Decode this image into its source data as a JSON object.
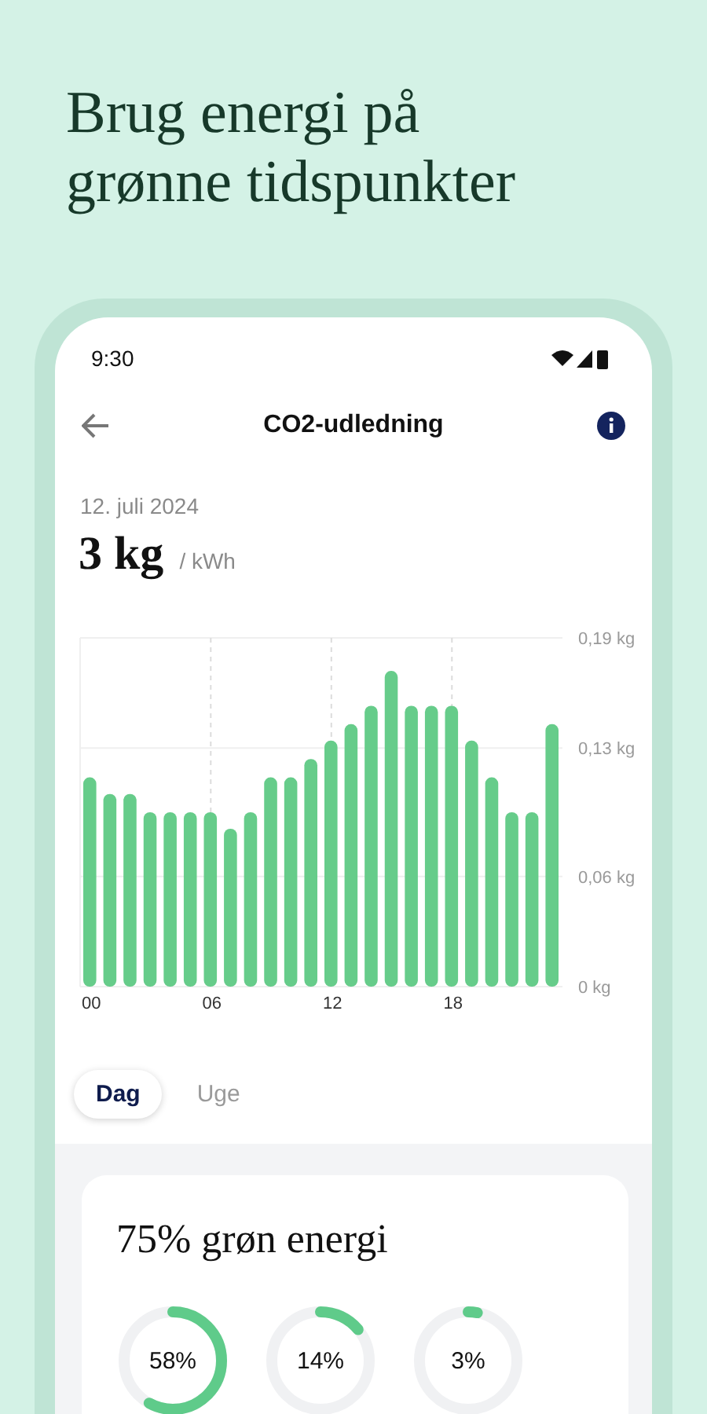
{
  "headline": "Brug energi på grønne tidspunkter",
  "status_bar": {
    "time": "9:30"
  },
  "header": {
    "title": "CO2-udledning"
  },
  "summary": {
    "date": "12. juli 2024",
    "value": "3 kg",
    "unit": "/ kWh"
  },
  "chart": {
    "chart_data": {
      "type": "bar",
      "ylim": [
        0,
        0.19
      ],
      "yticks": [
        {
          "value": 0.19,
          "label": "0,19 kg"
        },
        {
          "value": 0.13,
          "label": "0,13 kg"
        },
        {
          "value": 0.06,
          "label": "0,06 kg"
        },
        {
          "value": 0,
          "label": "0 kg"
        }
      ],
      "xlim": [
        -0.5,
        23.5
      ],
      "grid": true,
      "x": [
        0,
        1,
        2,
        3,
        4,
        5,
        6,
        7,
        8,
        9,
        10,
        11,
        12,
        13,
        14,
        15,
        16,
        17,
        18,
        19,
        20,
        21,
        22,
        23
      ],
      "xticks": [
        {
          "value": 0,
          "label": "00"
        },
        {
          "value": 6,
          "label": "06"
        },
        {
          "value": 12,
          "label": "12"
        },
        {
          "value": 18,
          "label": "18"
        }
      ],
      "series": [
        {
          "color": "#66cc8a",
          "values": [
            0.114,
            0.105,
            0.105,
            0.095,
            0.095,
            0.095,
            0.095,
            0.086,
            0.095,
            0.114,
            0.114,
            0.124,
            0.134,
            0.143,
            0.153,
            0.172,
            0.153,
            0.153,
            0.153,
            0.134,
            0.114,
            0.095,
            0.095,
            0.143
          ]
        }
      ]
    }
  },
  "tabs": [
    {
      "label": "Dag",
      "selected": true
    },
    {
      "label": "Uge",
      "selected": false
    }
  ],
  "green_card": {
    "title": "75% grøn energi",
    "rings": [
      {
        "label": "58%",
        "level": 0.58
      },
      {
        "label": "14%",
        "level": 0.14
      },
      {
        "label": "3%",
        "level": 0.03
      }
    ]
  }
}
